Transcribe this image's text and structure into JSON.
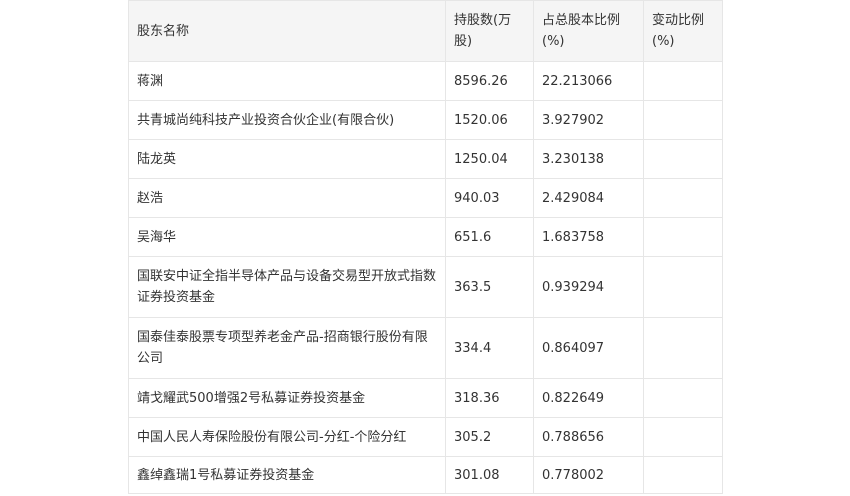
{
  "headers": {
    "name": "股东名称",
    "shares": "持股数(万股)",
    "ratio": "占总股本比例(%)",
    "change": "变动比例(%)"
  },
  "rows": [
    {
      "name": "蒋渊",
      "shares": "8596.26",
      "ratio": "22.213066",
      "change": ""
    },
    {
      "name": "共青城尚纯科技产业投资合伙企业(有限合伙)",
      "shares": "1520.06",
      "ratio": "3.927902",
      "change": ""
    },
    {
      "name": "陆龙英",
      "shares": "1250.04",
      "ratio": "3.230138",
      "change": ""
    },
    {
      "name": "赵浩",
      "shares": "940.03",
      "ratio": "2.429084",
      "change": ""
    },
    {
      "name": "吴海华",
      "shares": "651.6",
      "ratio": "1.683758",
      "change": ""
    },
    {
      "name": "国联安中证全指半导体产品与设备交易型开放式指数证券投资基金",
      "shares": "363.5",
      "ratio": "0.939294",
      "change": ""
    },
    {
      "name": "国泰佳泰股票专项型养老金产品-招商银行股份有限公司",
      "shares": "334.4",
      "ratio": "0.864097",
      "change": ""
    },
    {
      "name": "靖戈耀武500增强2号私募证券投资基金",
      "shares": "318.36",
      "ratio": "0.822649",
      "change": ""
    },
    {
      "name": "中国人民人寿保险股份有限公司-分红-个险分红",
      "shares": "305.2",
      "ratio": "0.788656",
      "change": ""
    },
    {
      "name": "鑫绰鑫瑞1号私募证券投资基金",
      "shares": "301.08",
      "ratio": "0.778002",
      "change": ""
    }
  ]
}
